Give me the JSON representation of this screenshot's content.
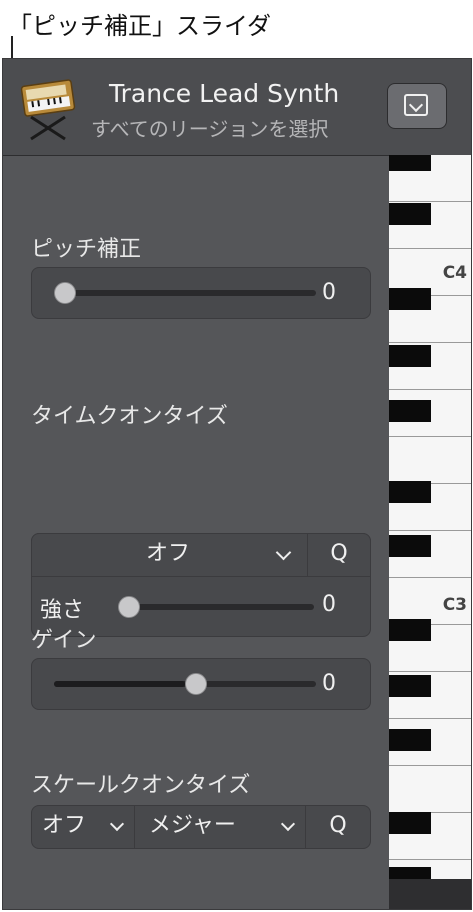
{
  "callout": {
    "label": "「ピッチ補正」スライダ"
  },
  "header": {
    "title": "Trance Lead Synth",
    "subtitle": "すべてのリージョンを選択",
    "icon": "synth-keyboard-icon",
    "menu_icon": "chevron-down-icon"
  },
  "pitch": {
    "label": "ピッチ補正",
    "value": "0",
    "position": 0.0
  },
  "time_quantize": {
    "label": "タイムクオンタイズ",
    "selected": "オフ",
    "q_label": "Q",
    "strength_label": "強さ",
    "strength_value": "0",
    "strength_position": 0.0
  },
  "gain": {
    "label": "ゲイン",
    "value": "0",
    "position": 0.5
  },
  "scale_quantize": {
    "label": "スケールクオンタイズ",
    "key": "オフ",
    "scale": "メジャー",
    "q_label": "Q"
  },
  "keyboard": {
    "labels": {
      "c4": "C4",
      "c3": "C3"
    }
  },
  "colors": {
    "panel": "#555659",
    "header": "#4c4d50",
    "control": "#48494c"
  }
}
